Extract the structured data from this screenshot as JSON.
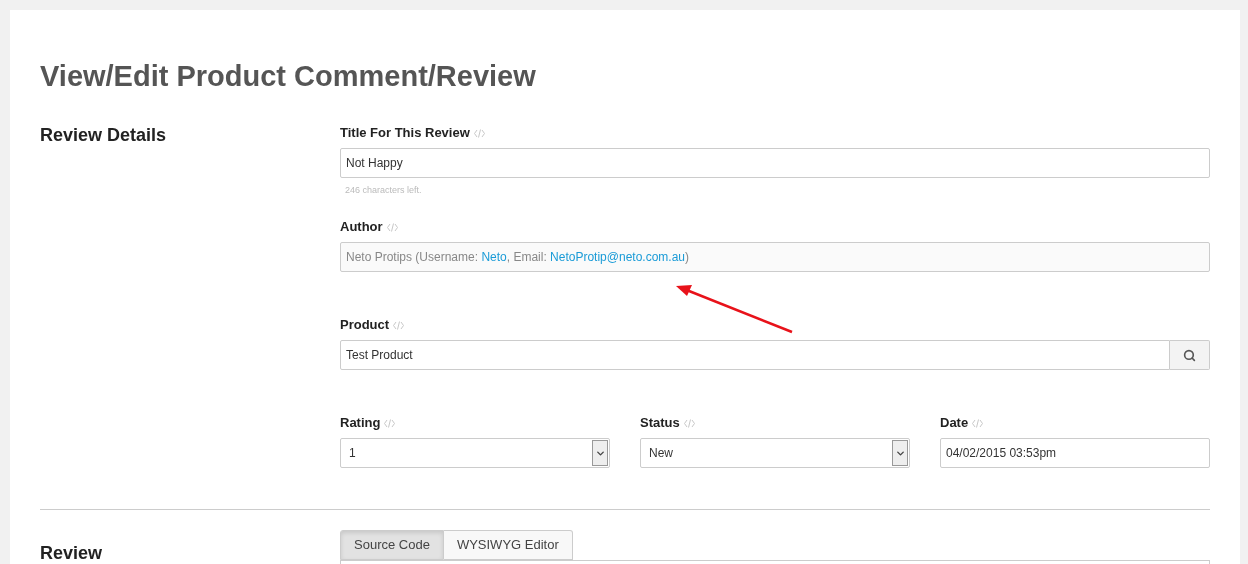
{
  "page_title": "View/Edit Product Comment/Review",
  "sections": [
    {
      "title": "Review Details"
    },
    {
      "title": "Review"
    }
  ],
  "title_field": {
    "label": "Title For This Review",
    "value": "Not Happy",
    "help": "246 characters left."
  },
  "author": {
    "label": "Author",
    "parts": [
      {
        "kind": "text",
        "text": "Neto Protips (Username: "
      },
      {
        "kind": "link",
        "text": "Neto"
      },
      {
        "kind": "text",
        "text": ", Email: "
      },
      {
        "kind": "link",
        "text": "NetoProtip@neto.com.au"
      },
      {
        "kind": "text",
        "text": ")"
      }
    ]
  },
  "product": {
    "label": "Product",
    "value": "Test Product"
  },
  "row_fields": [
    {
      "kind": "select",
      "label": "Rating",
      "value": "1"
    },
    {
      "kind": "select",
      "label": "Status",
      "value": "New"
    },
    {
      "kind": "input",
      "label": "Date",
      "value": "04/02/2015 03:53pm"
    }
  ],
  "editor_tabs": [
    {
      "label": "Source Code",
      "selected": true
    },
    {
      "label": "WYSIWYG Editor",
      "selected": false
    }
  ]
}
